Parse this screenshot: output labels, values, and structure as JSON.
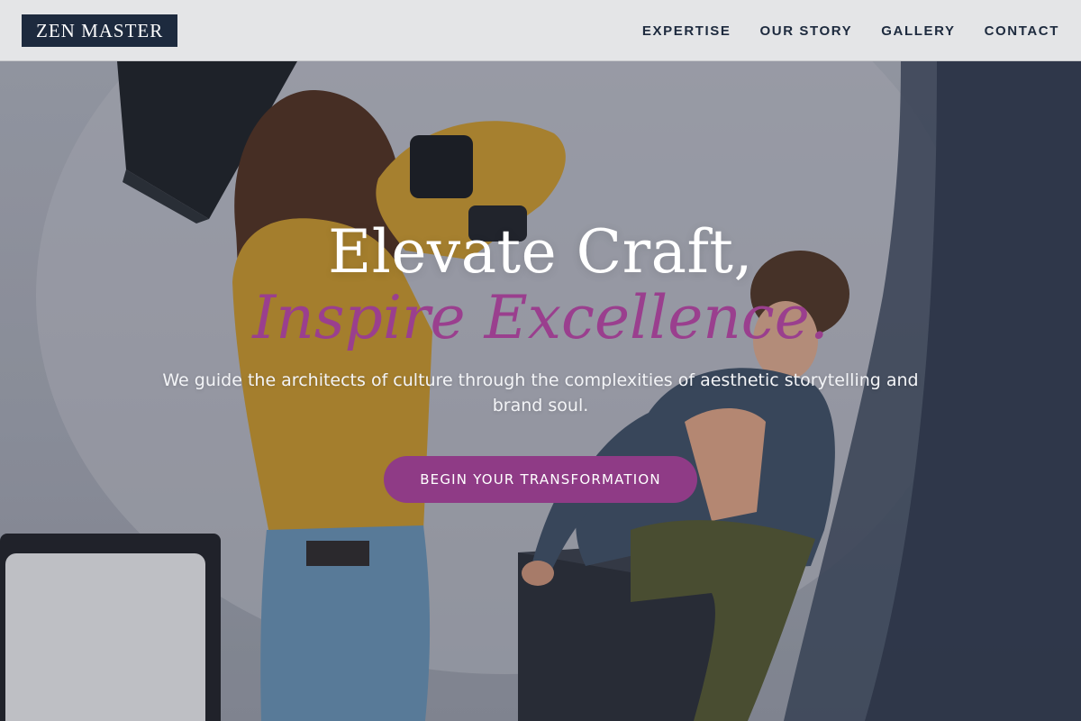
{
  "header": {
    "logo": "ZEN MASTER",
    "nav": [
      {
        "label": "EXPERTISE"
      },
      {
        "label": "OUR STORY"
      },
      {
        "label": "GALLERY"
      },
      {
        "label": "CONTACT"
      }
    ]
  },
  "hero": {
    "headline_line1": "Elevate Craft,",
    "headline_line2": "Inspire Excellence.",
    "subtitle": "We guide the architects of culture through the complexities of aesthetic storytelling and brand soul.",
    "cta_label": "BEGIN YOUR TRANSFORMATION"
  },
  "colors": {
    "brand_navy": "#1d2a3e",
    "accent_purple": "#8f3b86",
    "header_bg": "#e4e5e7"
  },
  "icons": [
    "hero-photo"
  ]
}
